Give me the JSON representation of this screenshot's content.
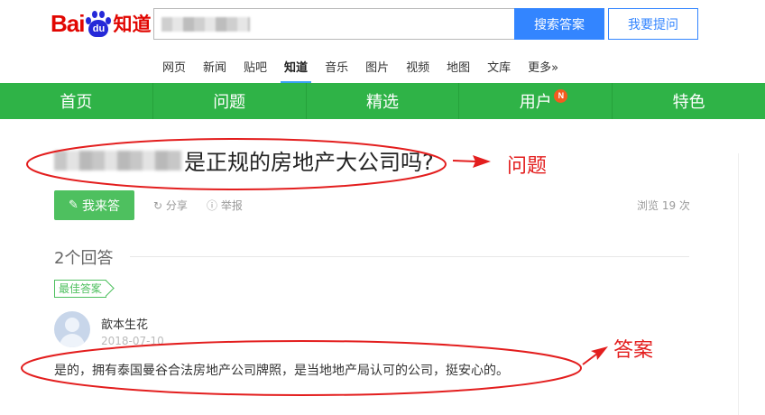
{
  "header": {
    "logo_bai": "Bai",
    "logo_du": "du",
    "logo_zhidao": "知道",
    "search_button": "搜索答案",
    "ask_button": "我要提问"
  },
  "channels": [
    "网页",
    "新闻",
    "贴吧",
    "知道",
    "音乐",
    "图片",
    "视频",
    "地图",
    "文库",
    "更多»"
  ],
  "active_channel": "知道",
  "greenbar": {
    "items": [
      "首页",
      "问题",
      "精选",
      "用户",
      "特色"
    ],
    "user_badge": "N"
  },
  "question": {
    "title_suffix": "是正规的房地产大公司吗?",
    "answer_button": "我来答",
    "share": "分享",
    "report": "举报",
    "views": "浏览 19 次"
  },
  "answers": {
    "count_label": "2个回答",
    "best_tag": "最佳答案",
    "username": "歆本生花",
    "date": "2018-07-10",
    "text": "是的，拥有泰国曼谷合法房地产公司牌照，是当地地产局认可的公司，挺安心的。"
  },
  "annotations": {
    "question_label": "问题",
    "answer_label": "答案"
  },
  "colors": {
    "brand_red": "#e10601",
    "baidu_blue": "#2529d8",
    "search_blue": "#3385ff",
    "green_bar": "#2fb347",
    "answer_green": "#4ec05f",
    "annotation_red": "#e31e1e"
  }
}
